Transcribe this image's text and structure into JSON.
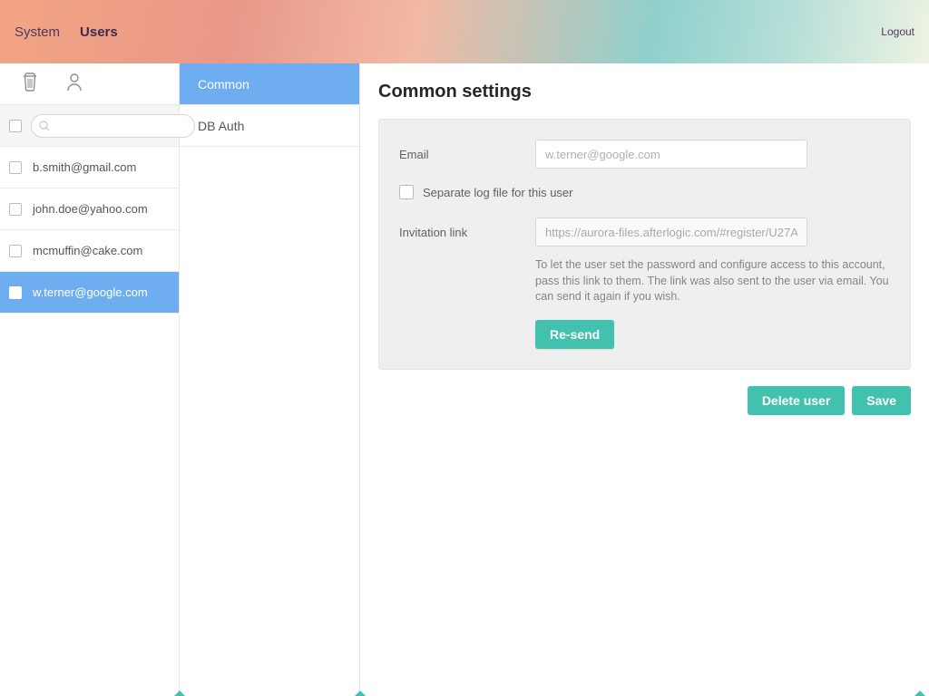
{
  "nav": {
    "system": "System",
    "users": "Users",
    "logout": "Logout"
  },
  "userlist": {
    "items": [
      {
        "email": "b.smith@gmail.com"
      },
      {
        "email": "john.doe@yahoo.com"
      },
      {
        "email": "mcmuffin@cake.com"
      },
      {
        "email": "w.terner@google.com"
      }
    ]
  },
  "subnav": {
    "common": "Common",
    "dbauth": "DB Auth"
  },
  "settings": {
    "title": "Common settings",
    "email_label": "Email",
    "email_value": "w.terner@google.com",
    "logfile_label": "Separate log file for this user",
    "invite_label": "Invitation link",
    "invite_value": "https://aurora-files.afterlogic.com/#register/U27A",
    "invite_help": "To let the user set the password and configure access to this account, pass this link to them. The link was also sent to the user via email. You can send it again if you wish.",
    "resend": "Re-send",
    "delete": "Delete user",
    "save": "Save"
  }
}
